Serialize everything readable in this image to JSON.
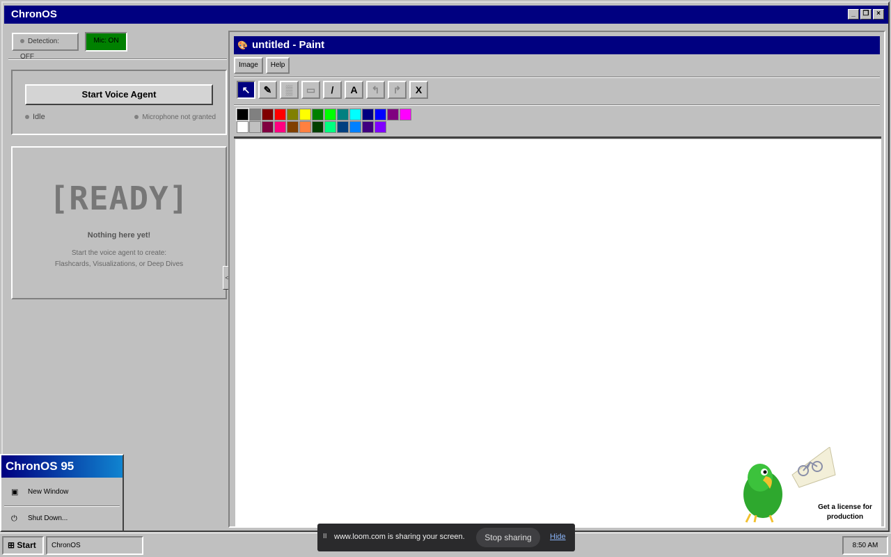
{
  "window": {
    "title": "ChronOS",
    "controls": {
      "minimize": "_",
      "restore": "❐",
      "close": "×"
    }
  },
  "left_panel": {
    "detection_label": "Detection: OFF",
    "mic_label": "Mic: ON",
    "mic_color": "#008000",
    "start_voice_label": "Start Voice Agent",
    "status_idle": "Idle",
    "status_mic": "Microphone not granted",
    "ready_title": "[READY]",
    "ready_empty": "Nothing here yet!",
    "ready_hint_line1": "Start the voice agent to create:",
    "ready_hint_line2": "Flashcards, Visualizations, or Deep Dives",
    "collapse_glyph": "<"
  },
  "paint": {
    "title": "untitled  - Paint",
    "menu": [
      "Image",
      "Help"
    ],
    "tools": [
      {
        "name": "select-tool-icon",
        "glyph": "↖",
        "active": true
      },
      {
        "name": "pencil-tool-icon",
        "glyph": "✎",
        "active": false
      },
      {
        "name": "fill-tool-icon",
        "glyph": "▒",
        "active": false
      },
      {
        "name": "rectangle-tool-icon",
        "glyph": "▭",
        "active": false
      },
      {
        "name": "line-tool-icon",
        "glyph": "/",
        "active": false
      },
      {
        "name": "text-tool-icon",
        "glyph": "A",
        "active": false
      },
      {
        "name": "undo-icon",
        "glyph": "↰",
        "active": false
      },
      {
        "name": "redo-icon",
        "glyph": "↱",
        "active": false
      },
      {
        "name": "clear-icon",
        "glyph": "X",
        "active": false
      }
    ],
    "palette_row1": [
      "#000000",
      "#808080",
      "#800000",
      "#ff0000",
      "#808000",
      "#ffff00",
      "#008000",
      "#00ff00",
      "#008080",
      "#00ffff",
      "#000080",
      "#0000ff",
      "#800080",
      "#ff00ff"
    ],
    "palette_row2": [
      "#ffffff",
      "#c0c0c0",
      "#800040",
      "#ff0080",
      "#804000",
      "#ff8040",
      "#004000",
      "#00ff80",
      "#004080",
      "#0080ff",
      "#400080",
      "#8000ff"
    ]
  },
  "mascot": {
    "license_line1": "Get a license for",
    "license_line2": "production"
  },
  "start_menu": {
    "banner": "ChronOS 95",
    "items": [
      {
        "label": "New Window",
        "icon": "▣"
      },
      {
        "label": "Shut Down...",
        "icon": "⏻"
      }
    ]
  },
  "taskbar": {
    "start_label": "Start",
    "task_label": "ChronOS",
    "clock": "8:50 AM"
  },
  "loom": {
    "pause_glyph": "II",
    "message": "www.loom.com is sharing your screen.",
    "stop_label": "Stop sharing",
    "hide_label": "Hide"
  }
}
